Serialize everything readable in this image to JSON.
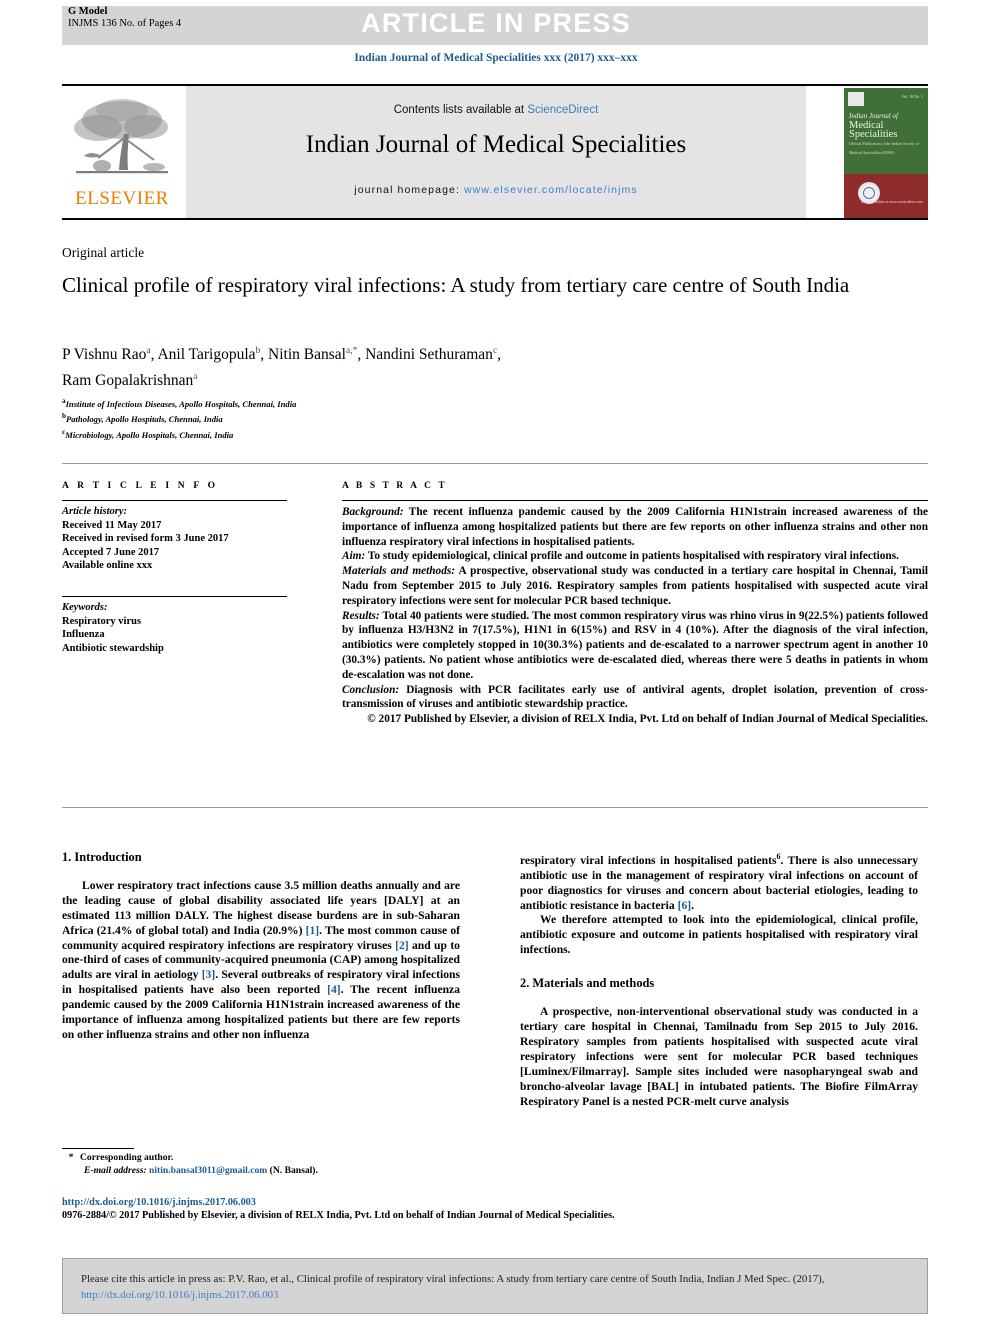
{
  "header": {
    "g_model": "G Model",
    "model_line2_prefix": "INJMS",
    "model_line2": "INJMS 136 No. of Pages 4",
    "article_in_press": "ARTICLE IN PRESS",
    "journal_running_head": "Indian Journal of Medical Specialities xxx (2017) xxx–xxx"
  },
  "masthead": {
    "contents_prefix": "Contents lists available at ",
    "sciencedirect": "ScienceDirect",
    "journal_title": "Indian Journal of Medical Specialities",
    "homepage_label": "journal homepage:",
    "homepage_url": "www.elsevier.com/locate/injms",
    "elsevier_wordmark": "ELSEVIER",
    "cover": {
      "line1": "Indian Journal of",
      "line2": "Medical Specialities",
      "line3": "Official Publication of the Indian Society of Medical Specialities (ISMS)",
      "issue": "Vol. 18  No. 1",
      "bottom": "Available online at www.sciencedirect.com"
    }
  },
  "article": {
    "type": "Original article",
    "title": "Clinical profile of respiratory viral infections: A study from tertiary care centre of South India",
    "authors": [
      {
        "name": "P Vishnu Rao",
        "sup": "a"
      },
      {
        "name": "Anil Tarigopula",
        "sup": "b"
      },
      {
        "name": "Nitin Bansal",
        "sup": "a,*"
      },
      {
        "name": "Nandini Sethuraman",
        "sup": "c"
      },
      {
        "name": "Ram Gopalakrishnan",
        "sup": "a"
      }
    ],
    "affiliations": [
      {
        "sup": "a",
        "text": "Institute of Infectious Diseases, Apollo Hospitals, Chennai, India"
      },
      {
        "sup": "b",
        "text": "Pathology, Apollo Hospitals, Chennai, India"
      },
      {
        "sup": "c",
        "text": "Microbiology, Apollo Hospitals, Chennai, India"
      }
    ]
  },
  "article_info": {
    "heading": "A R T I C L E  I N F O",
    "history_title": "Article history:",
    "history": [
      "Received 11 May 2017",
      "Received in revised form 3 June 2017",
      "Accepted 7 June 2017",
      "Available online xxx"
    ],
    "keywords_title": "Keywords:",
    "keywords": [
      "Respiratory virus",
      "Influenza",
      "Antibiotic stewardship"
    ]
  },
  "abstract": {
    "heading": "A B S T R A C T",
    "sections": [
      {
        "label": "Background:",
        "text": " The recent influenza pandemic caused by the 2009 California H1N1strain increased awareness of the importance of influenza among hospitalized patients but there are few reports on other influenza strains and other non influenza respiratory viral infections in hospitalised patients."
      },
      {
        "label": "Aim:",
        "text": " To study epidemiological, clinical profile and outcome in patients hospitalised with respiratory viral infections."
      },
      {
        "label": "Materials and methods:",
        "text": " A prospective, observational study was conducted in a tertiary care hospital in Chennai, Tamil Nadu from September 2015 to July 2016. Respiratory samples from patients hospitalised with suspected acute viral respiratory infections were sent for molecular PCR based technique."
      },
      {
        "label": "Results:",
        "text": " Total 40 patients were studied. The most common respiratory virus was rhino virus in 9(22.5%) patients followed by influenza H3/H3N2 in 7(17.5%), H1N1 in 6(15%) and RSV in 4 (10%). After the diagnosis of the viral infection, antibiotics were completely stopped in 10(30.3%) patients and de-escalated to a narrower spectrum agent in another 10 (30.3%) patients. No patient whose antibiotics were de-escalated died, whereas there were 5 deaths in patients in whom de-escalation was not done."
      },
      {
        "label": "Conclusion:",
        "text": " Diagnosis with PCR facilitates early use of antiviral agents, droplet isolation, prevention of cross-transmission of viruses and antibiotic stewardship practice."
      }
    ],
    "copyright": "© 2017 Published by Elsevier, a division of RELX India, Pvt. Ltd on behalf of Indian Journal of Medical Specialities."
  },
  "body": {
    "left": {
      "section_1_heading": "1. Introduction",
      "para_1_a": "Lower respiratory tract infections cause 3.5 million deaths annually and are the leading cause of global disability associated life years [DALY] at an estimated 113 million DALY. The highest disease burdens are in sub-Saharan Africa (21.4% of global total) and India (20.9%) ",
      "ref_1": "[1]",
      "para_1_b": ". The most common cause of community acquired respiratory infections are respiratory viruses ",
      "ref_2": "[2]",
      "para_1_c": " and up to one-third of cases of community-acquired pneumonia (CAP) among hospitalized adults are viral in aetiology ",
      "ref_3": "[3]",
      "para_1_d": ". Several outbreaks of respiratory viral infections in hospitalised patients have also been reported ",
      "ref_4": "[4]",
      "para_1_e": ". The recent influenza pandemic caused by the 2009 California H1N1strain increased awareness of the importance of influenza among hospitalized patients but there are few reports on other influenza strains and other non influenza"
    },
    "right": {
      "para_2_a": "respiratory viral infections in hospitalised patients",
      "sup_6": "6",
      "para_2_b": ". There is also unnecessary antibiotic use in the management of respiratory viral infections on account of poor diagnostics for viruses and concern about bacterial etiologies, leading to antibiotic resistance in bacteria ",
      "ref_6": "[6]",
      "para_2_c": ".",
      "para_3": "We therefore attempted to look into the epidemiological, clinical profile, antibiotic exposure and outcome in patients hospitalised with respiratory viral infections.",
      "section_2_heading": "2. Materials and methods",
      "para_4": "A prospective, non-interventional observational study was conducted in a tertiary care hospital in Chennai, Tamilnadu from Sep 2015 to July 2016. Respiratory samples from patients hospitalised with suspected acute viral respiratory infections were sent for molecular PCR based techniques [Luminex/Filmarray]. Sample sites included were nasopharyngeal swab and broncho-alveolar lavage [BAL] in intubated patients. The Biofire FilmArray Respiratory Panel is a nested PCR-melt curve analysis"
    }
  },
  "footnote": {
    "star": "*",
    "corresponding": "Corresponding author.",
    "email_label": "E-mail address:",
    "email": "nitin.bansal3011@gmail.com",
    "email_owner": "(N. Bansal)."
  },
  "footer": {
    "doi": "http://dx.doi.org/10.1016/j.injms.2017.06.003",
    "issn_line": "0976-2884/© 2017 Published by Elsevier, a division of RELX India, Pvt. Ltd on behalf of Indian Journal of Medical Specialities."
  },
  "cite_box": {
    "line1": "Please cite this article in press as: P.V. Rao, et al., Clinical profile of respiratory viral infections: A study from tertiary care centre of South India,",
    "line2_prefix": "Indian J Med Spec. (2017), ",
    "line2_link": "http://dx.doi.org/10.1016/j.injms.2017.06.003"
  },
  "colors": {
    "link_blue": "#3a7fc1",
    "header_blue": "#1a5c93",
    "elsevier_orange": "#f07d00",
    "grey_bar": "#d4d4d4",
    "masthead_grey": "#e4e4e4"
  }
}
